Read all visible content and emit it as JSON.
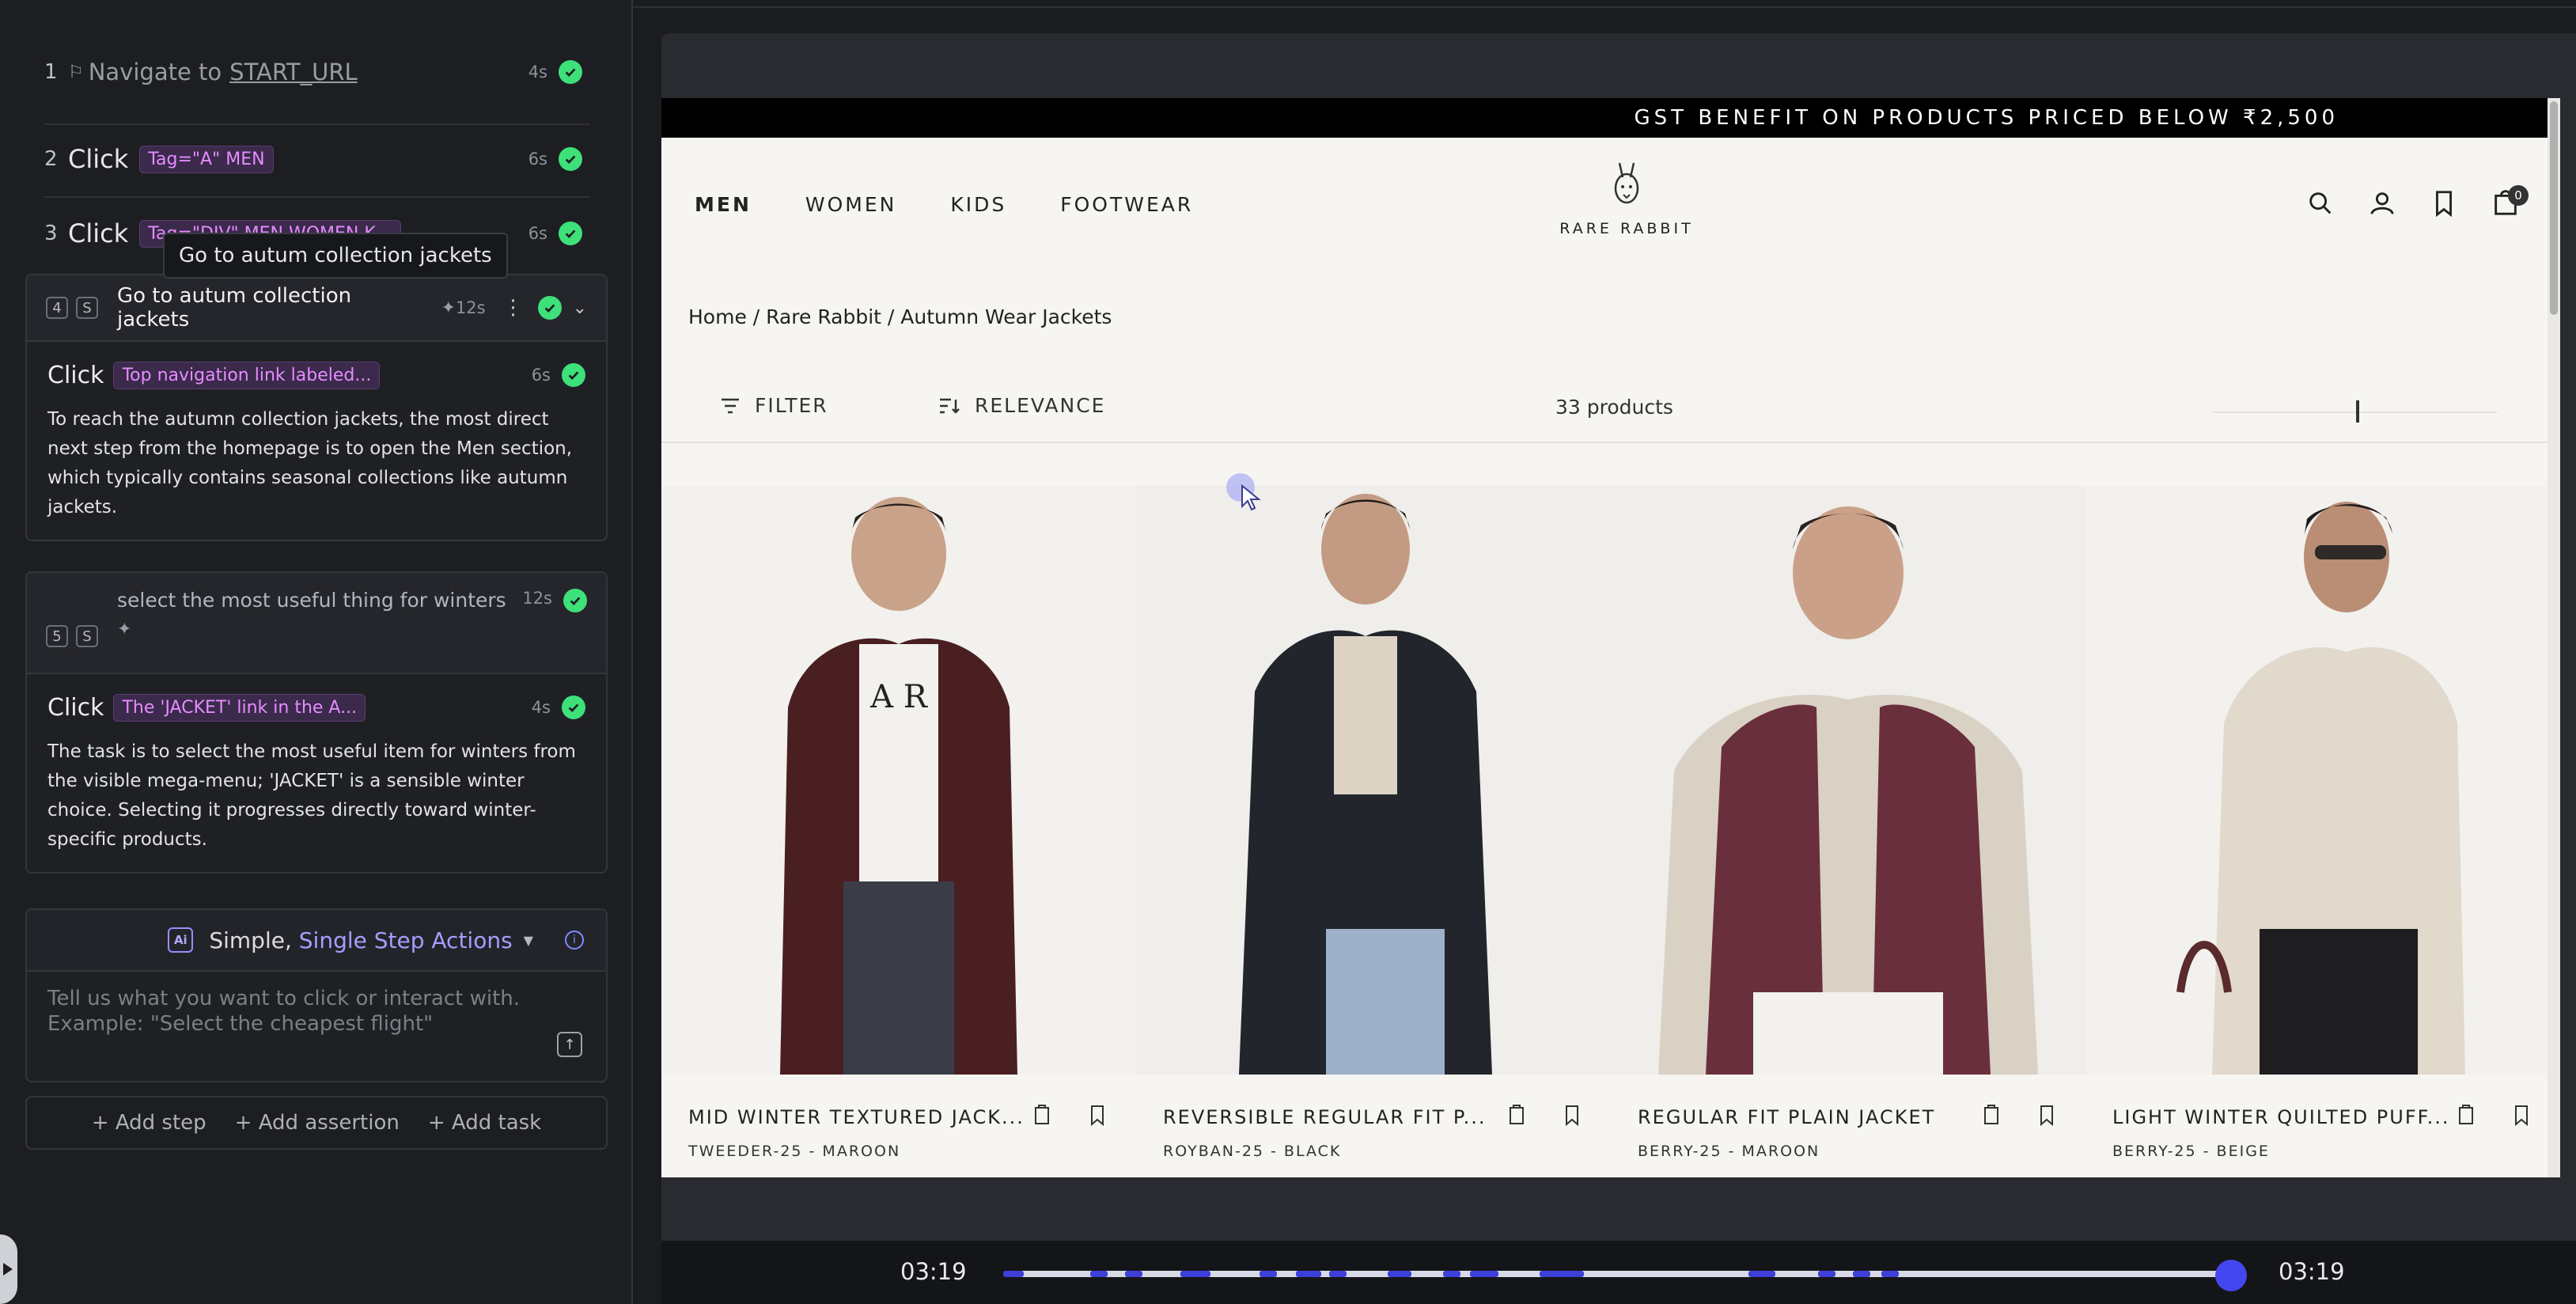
{
  "steps": [
    {
      "num": "1",
      "action": "Navigate to",
      "target": "START_URL",
      "time": "4s"
    },
    {
      "num": "2",
      "action": "Click",
      "target": "Tag=\"A\" MEN",
      "time": "6s"
    },
    {
      "num": "3",
      "action": "Click",
      "target": "Tag=\"DIV\" MEN WOMEN K...",
      "time": "6s"
    }
  ],
  "tooltip": "Go to autum collection jackets",
  "task4": {
    "num": "4",
    "badge": "S",
    "title": "Go to autum collection jackets",
    "time": "12s",
    "sub_action": "Click",
    "sub_target": "Top navigation link labeled...",
    "sub_time": "6s",
    "description": "To reach the autumn collection jackets, the most direct next step from the homepage is to open the Men section, which typically contains seasonal collections like autumn jackets."
  },
  "task5": {
    "num": "5",
    "badge": "S",
    "title": "select the most useful thing for winters",
    "time": "12s",
    "sub_action": "Click",
    "sub_target": "The 'JACKET' link in the A...",
    "sub_time": "4s",
    "description": "The task is to select the most useful item for winters from the visible mega-menu; 'JACKET' is a sensible winter choice. Selecting it progresses directly toward winter-specific products."
  },
  "prompt": {
    "mode_prefix": "Simple, ",
    "mode_highlight": "Single Step Actions",
    "placeholder": "Tell us what you want to click or interact with. Example: \"Select the cheapest flight\""
  },
  "add_bar": [
    "+ Add step",
    "+ Add assertion",
    "+ Add task"
  ],
  "site": {
    "announcement": "GST BENEFIT ON PRODUCTS PRICED BELOW ₹2,500",
    "nav": [
      "MEN",
      "WOMEN",
      "KIDS",
      "FOOTWEAR"
    ],
    "logo": "RARE RABBIT",
    "cart_count": "0",
    "breadcrumb": "Home / Rare Rabbit / Autumn Wear Jackets",
    "filter": "FILTER",
    "sort": "RELEVANCE",
    "count": "33 products"
  },
  "products": [
    {
      "name": "MID WINTER TEXTURED JACK...",
      "sub": "TWEEDER-25 - MAROON",
      "color": "#4a1f22"
    },
    {
      "name": "REVERSIBLE REGULAR FIT P...",
      "sub": "ROYBAN-25 - BLACK",
      "color": "#22252b"
    },
    {
      "name": "REGULAR FIT PLAIN JACKET",
      "sub": "BERRY-25 - MAROON",
      "color": "#6a2f3c"
    },
    {
      "name": "LIGHT WINTER QUILTED PUFF...",
      "sub": "BERRY-25 - BEIGE",
      "color": "#e1d9cb"
    }
  ],
  "timeline": {
    "current": "03:19",
    "total": "03:19",
    "progress": 1.0
  }
}
